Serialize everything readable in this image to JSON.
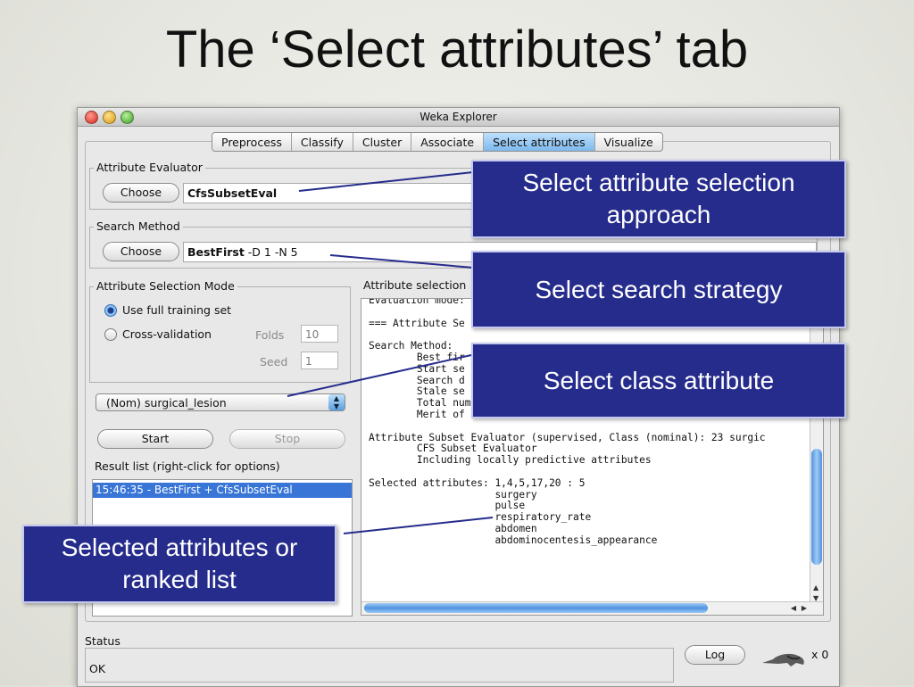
{
  "slide": {
    "title": "The ‘Select attributes’ tab"
  },
  "window": {
    "title": "Weka Explorer"
  },
  "tabs": [
    "Preprocess",
    "Classify",
    "Cluster",
    "Associate",
    "Select attributes",
    "Visualize"
  ],
  "evaluator": {
    "label": "Attribute Evaluator",
    "choose": "Choose",
    "value": "CfsSubsetEval"
  },
  "search": {
    "label": "Search Method",
    "choose": "Choose",
    "value_bold": "BestFirst",
    "value_rest": " -D 1 -N 5"
  },
  "mode": {
    "label": "Attribute Selection Mode",
    "full": "Use full training set",
    "cv": "Cross-validation",
    "folds_label": "Folds",
    "folds": "10",
    "seed_label": "Seed",
    "seed": "1"
  },
  "class_select": "(Nom) surgical_lesion",
  "start": "Start",
  "stop": "Stop",
  "results": {
    "label": "Result list (right-click for options)",
    "items": [
      "15:46:35 - BestFirst + CfsSubsetEval"
    ]
  },
  "output": {
    "label": "Attribute selection",
    "lines": [
      "Evaluation mode:",
      "",
      "=== Attribute Se",
      "",
      "Search Method:",
      "        Best fir",
      "        Start se",
      "        Search d",
      "        Stale se",
      "        Total number of subsets evaluated: 115",
      "        Merit of best subset found:    0.294",
      "",
      "Attribute Subset Evaluator (supervised, Class (nominal): 23 surgic",
      "        CFS Subset Evaluator",
      "        Including locally predictive attributes",
      "",
      "Selected attributes: 1,4,5,17,20 : 5",
      "                     surgery",
      "                     pulse",
      "                     respiratory_rate",
      "                     abdomen",
      "                     abdominocentesis_appearance"
    ]
  },
  "status": {
    "label": "Status",
    "text": "OK"
  },
  "log": "Log",
  "bird_count": "x 0",
  "callouts": {
    "evaluator": "Select attribute selection approach",
    "search": "Select search strategy",
    "class": "Select class attribute",
    "results": "Selected attributes or ranked list"
  },
  "colors": {
    "callout_bg": "#262c8c",
    "selected_tab": "#7eb9ee",
    "list_selection": "#3875d7"
  }
}
